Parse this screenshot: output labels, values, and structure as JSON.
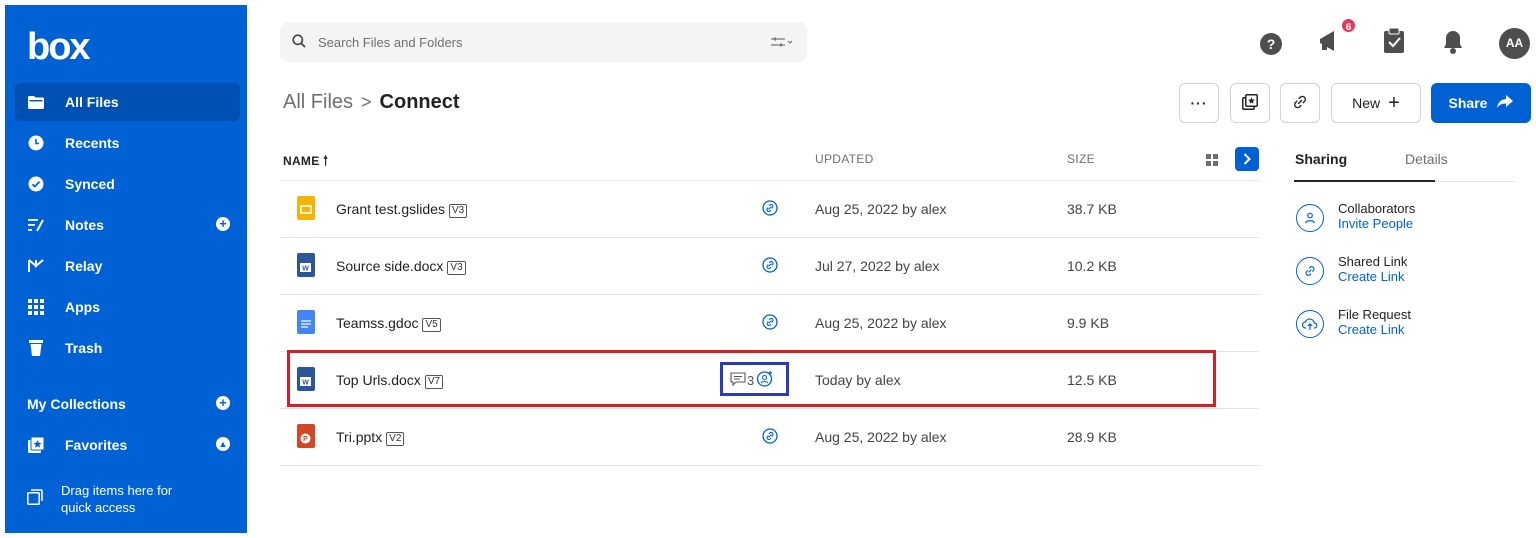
{
  "sidebar": {
    "logo": "box",
    "items": [
      {
        "label": "All Files"
      },
      {
        "label": "Recents"
      },
      {
        "label": "Synced"
      },
      {
        "label": "Notes"
      },
      {
        "label": "Relay"
      },
      {
        "label": "Apps"
      },
      {
        "label": "Trash"
      }
    ],
    "collections_label": "My Collections",
    "favorites_label": "Favorites",
    "drag_hint_line1": "Drag items here for",
    "drag_hint_line2": "quick access"
  },
  "search": {
    "placeholder": "Search Files and Folders"
  },
  "header": {
    "notifications_badge": "6",
    "avatar_initials": "AA",
    "breadcrumb_root": "All Files",
    "breadcrumb_separator": ">",
    "breadcrumb_current": "Connect",
    "more_label": "···",
    "new_label": "New",
    "share_label": "Share"
  },
  "table": {
    "columns": {
      "name": "NAME",
      "updated": "UPDATED",
      "size": "SIZE"
    },
    "rows": [
      {
        "name": "Grant test.gslides",
        "version": "V3",
        "updated": "Aug 25, 2022 by alex",
        "size": "38.7 KB",
        "icon": "gslides-icon"
      },
      {
        "name": "Source side.docx",
        "version": "V3",
        "updated": "Jul 27, 2022 by alex",
        "size": "10.2 KB",
        "icon": "docx-icon"
      },
      {
        "name": "Teamss.gdoc",
        "version": "V5",
        "updated": "Aug 25, 2022 by alex",
        "size": "9.9 KB",
        "icon": "gdoc-icon"
      },
      {
        "name": "Top Urls.docx",
        "version": "V7",
        "updated": "Today by alex",
        "size": "12.5 KB",
        "icon": "docx-icon",
        "comments": "3"
      },
      {
        "name": "Tri.pptx",
        "version": "V2",
        "updated": "Aug 25, 2022 by alex",
        "size": "28.9 KB",
        "icon": "pptx-icon"
      }
    ]
  },
  "panel": {
    "tab_sharing": "Sharing",
    "tab_details": "Details",
    "items": [
      {
        "title": "Collaborators",
        "action": "Invite People"
      },
      {
        "title": "Shared Link",
        "action": "Create Link"
      },
      {
        "title": "File Request",
        "action": "Create Link"
      }
    ]
  },
  "colors": {
    "brand_blue": "#0061d5",
    "highlight_red": "#d62027",
    "highlight_blue": "#2b3db5"
  }
}
